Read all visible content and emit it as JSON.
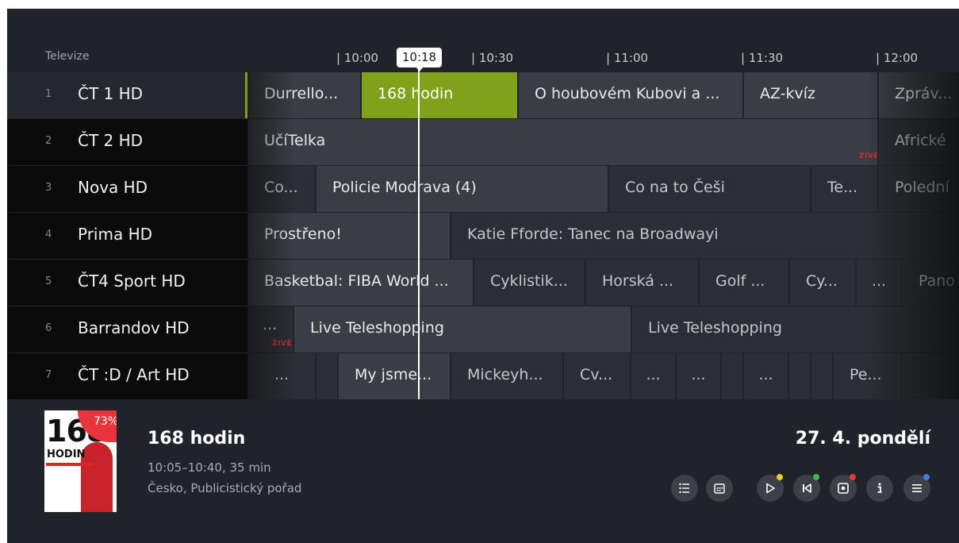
{
  "header": {
    "section_title": "Televize",
    "current_time": "10:18",
    "timeline_ticks": [
      "| 10:00",
      "| 10:30",
      "| 11:00",
      "| 11:30",
      "| 12:00"
    ]
  },
  "channels": [
    {
      "number": "1",
      "name": "ČT 1 HD",
      "programs": [
        "Durrello...",
        "168 hodin",
        "O houbovém Kubovi a ...",
        "AZ-kvíz",
        "Zpráv..."
      ]
    },
    {
      "number": "2",
      "name": "ČT 2 HD",
      "programs": [
        "UčíTelka",
        "Africké"
      ]
    },
    {
      "number": "3",
      "name": "Nova HD",
      "programs": [
        "Co...",
        "Policie Modrava (4)",
        "Co na to Češi",
        "Te...",
        "Polední"
      ]
    },
    {
      "number": "4",
      "name": "Prima HD",
      "programs": [
        "Prostřeno!",
        "Katie Fforde: Tanec na Broadwayi"
      ]
    },
    {
      "number": "5",
      "name": "ČT4 Sport HD",
      "programs": [
        "Basketbal: FIBA World ...",
        "Cyklistik...",
        "Horská ...",
        "Golf ...",
        "Cy...",
        "...",
        "Pano"
      ]
    },
    {
      "number": "6",
      "name": "Barrandov HD",
      "programs": [
        "...",
        "Live Teleshopping",
        "Live Teleshopping"
      ]
    },
    {
      "number": "7",
      "name": "ČT :D / Art HD",
      "programs": [
        "...",
        "My jsme...",
        "Mickeyh...",
        "Cv...",
        "...",
        "...",
        "...",
        "Pe..."
      ]
    }
  ],
  "live_label": "ŽIVĚ",
  "detail": {
    "title": "168 hodin",
    "time": "10:05–10:40, 35 min",
    "meta": "Česko, Publicistický pořad",
    "date": "27. 4. pondělí",
    "poster": {
      "title_line1": "168",
      "title_line2": "HODIN",
      "progress_label": "73%",
      "progress": 0.73
    }
  },
  "buttons": [
    {
      "icon": "list-icon",
      "dot_color": null
    },
    {
      "icon": "calendar-icon",
      "dot_color": null
    },
    {
      "icon": "play-icon",
      "dot_color": "#e6d21c"
    },
    {
      "icon": "skip-back-icon",
      "dot_color": "#3db84a"
    },
    {
      "icon": "record-icon",
      "dot_color": "#e8343a"
    },
    {
      "icon": "info-icon",
      "dot_color": null
    },
    {
      "icon": "menu-icon",
      "dot_color": "#3a7be8"
    }
  ],
  "colors": {
    "accent": "#80a11a",
    "background": "#202329",
    "now_line": "#ffffff",
    "live": "#d0302d"
  }
}
